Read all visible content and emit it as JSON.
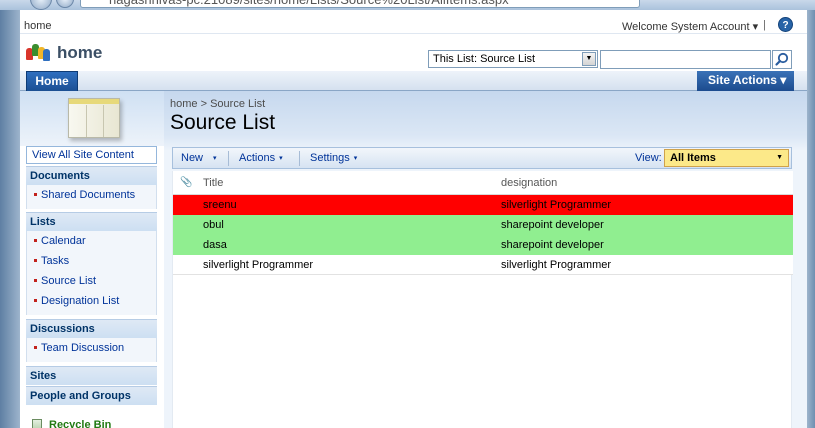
{
  "browser": {
    "address": "nagashnivas-pc:21089/sites/home/Lists/Source%20List/AllItems.aspx"
  },
  "topbar": {
    "home_link": "home",
    "welcome": "Welcome System Account",
    "welcome_caret": "▾",
    "separator": "|",
    "help_glyph": "?"
  },
  "site": {
    "title": "home",
    "logo_colors": [
      "#d9352b",
      "#3b8d2f",
      "#f0b629",
      "#2f6fbf"
    ]
  },
  "search": {
    "scope": "This List: Source List",
    "dropdown_glyph": "▼",
    "value": ""
  },
  "nav": {
    "home_tab": "Home",
    "site_actions": "Site Actions",
    "site_actions_caret": "▾"
  },
  "quicklaunch": {
    "view_all": "View All Site Content",
    "documents_header": "Documents",
    "documents_items": [
      "Shared Documents"
    ],
    "lists_header": "Lists",
    "lists_items": [
      "Calendar",
      "Tasks",
      "Source List",
      "Designation List"
    ],
    "discussions_header": "Discussions",
    "discussions_items": [
      "Team Discussion"
    ],
    "sites_header": "Sites",
    "people_header": "People and Groups",
    "recycle_bin": "Recycle Bin"
  },
  "content": {
    "breadcrumb_root": "home",
    "breadcrumb_sep": ">",
    "breadcrumb_current": "Source List",
    "title": "Source List"
  },
  "toolbar": {
    "new_label": "New",
    "actions_label": "Actions",
    "settings_label": "Settings",
    "caret": "▾",
    "view_label": "View:",
    "view_value": "All Items",
    "view_caret": "▼"
  },
  "list": {
    "attachment_glyph": "📎",
    "col_title": "Title",
    "col_designation": "designation",
    "rows": [
      {
        "title": "sreenu",
        "designation": "silverlight Programmer",
        "color": "#ff0000"
      },
      {
        "title": "obul",
        "designation": "sharepoint developer",
        "color": "#90ee90"
      },
      {
        "title": "dasa",
        "designation": "sharepoint developer",
        "color": "#90ee90"
      },
      {
        "title": "silverlight Programmer",
        "designation": "silverlight Programmer",
        "color": "#ffffff"
      }
    ]
  }
}
